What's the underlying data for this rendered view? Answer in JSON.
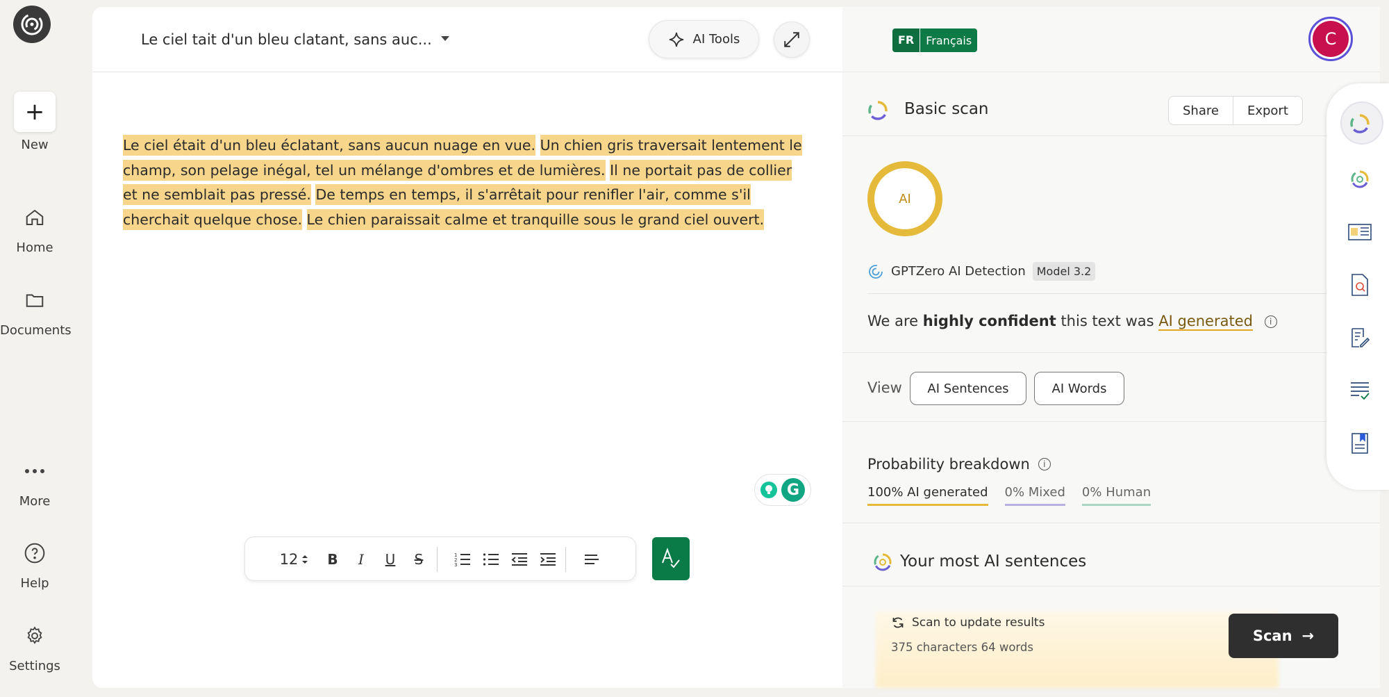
{
  "nav": {
    "new_label": "New",
    "home_label": "Home",
    "documents_label": "Documents",
    "more_label": "More",
    "help_label": "Help",
    "settings_label": "Settings"
  },
  "editor": {
    "title": "Le ciel tait d'un bleu clatant, sans auc...",
    "ai_tools_label": "AI Tools",
    "sentences": [
      "Le ciel était d'un bleu éclatant, sans aucun nuage en vue.",
      "Un chien gris traversait lentement le champ, son pelage inégal, tel un mélange d'ombres et de lumières.",
      "Il ne portait pas de collier et ne semblait pas pressé.",
      "De temps en temps, il s'arrêtait pour renifler l'air, comme s'il cherchait quelque chose.",
      "Le chien paraissait calme et tranquille sous le grand ciel ouvert."
    ],
    "highlight_color": "#f7d68c",
    "font_size": "12"
  },
  "results": {
    "lang_code": "FR",
    "lang_name": "Français",
    "avatar_letter": "C",
    "scan_title": "Basic scan",
    "share_label": "Share",
    "export_label": "Export",
    "ai_badge": "AI",
    "detector_name": "GPTZero AI Detection",
    "model_label": "Model 3.2",
    "confidence_prefix": "We are",
    "confidence_strong": "highly confident",
    "confidence_mid": "this text was",
    "confidence_verdict": "AI generated",
    "view_label": "View",
    "ai_sentences_label": "AI Sentences",
    "ai_words_label": "AI Words",
    "probability_title": "Probability breakdown",
    "prob_ai": "100% AI generated",
    "prob_mixed": "0% Mixed",
    "prob_human": "0% Human",
    "most_ai_title": "Your most AI sentences",
    "scan_update_text": "Scan to update results",
    "char_count": "375 characters 64 words",
    "scan_button": "Scan",
    "colors": {
      "ai": "#e5b93a",
      "mixed": "#b9b0e0",
      "human": "#a9d6c3",
      "brand_green": "#0a7a47"
    }
  }
}
